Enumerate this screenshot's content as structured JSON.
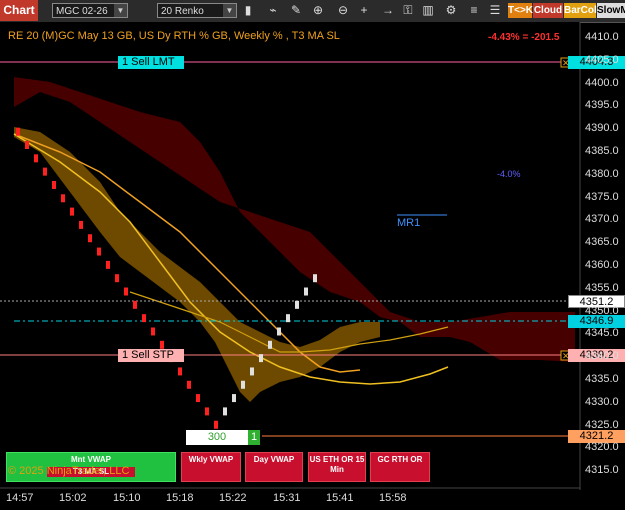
{
  "toolbar": {
    "chart_tab": "Chart",
    "instrument": "MGC 02-26",
    "bar_type": "20 Renko",
    "tk_label": "T<>K",
    "cloud_label": "Cloud",
    "barcol_label": "BarCol",
    "slowm_label": "SlowM"
  },
  "chart": {
    "title": "RE 20  (M)GC May 13 GB, US Dy RTH % GB, Weekly % , T3 MA SL",
    "pct_change": "-4.43% = -201.5",
    "note_pct": "-4.0%",
    "mr1_label": "MR1",
    "watermark": "© 2025 NinjaTrader, LLC"
  },
  "orders": {
    "sell_lmt": {
      "label": "1 Sell LMT",
      "price": "4404.3"
    },
    "sell_stp": {
      "label": "1 Sell STP",
      "price": "4339.2"
    },
    "qty_box": "300",
    "qty_tag": "1",
    "entry_price": "4321.2"
  },
  "price_tags": {
    "last": "4351.2",
    "ma": "4346.9"
  },
  "buttons": {
    "mnt_vwap": "Mnt VWAP",
    "t3_ma_sl": "T3 MA SL",
    "wkly_vwap": "Wkly VWAP",
    "day_vwap": "Day VWAP",
    "us_eth": "US ETH OR 15 Min",
    "gc_rth": "GC RTH OR"
  },
  "axis": {
    "y_ticks": [
      "4410.0",
      "4405.0",
      "4400.0",
      "4395.0",
      "4390.0",
      "4385.0",
      "4380.0",
      "4375.0",
      "4370.0",
      "4365.0",
      "4360.0",
      "4355.0",
      "4350.0",
      "4345.0",
      "4340.0",
      "4335.0",
      "4330.0",
      "4325.0",
      "4320.0",
      "4315.0"
    ],
    "x_ticks": [
      "14:57",
      "15:02",
      "15:10",
      "15:18",
      "15:22",
      "15:31",
      "15:41",
      "15:58"
    ]
  },
  "chart_data": {
    "type": "renko",
    "y_range": [
      4312,
      4412
    ],
    "bricks_down": [
      4390,
      4387,
      4384,
      4381,
      4378,
      4375,
      4372,
      4369,
      4366,
      4363,
      4360,
      4357,
      4354,
      4351,
      4348,
      4345,
      4342,
      4339,
      4336,
      4333,
      4330,
      4327,
      4324
    ],
    "bricks_up": [
      4327,
      4330,
      4333,
      4336,
      4339,
      4342,
      4345,
      4348,
      4351,
      4354,
      4357
    ]
  },
  "colors": {
    "accent_red": "#c0392b",
    "cloud_dark": "#4a0000",
    "cloud_orange": "#8a5a00",
    "ma_yellow": "#f0c020",
    "cyan": "#00d0e0"
  }
}
